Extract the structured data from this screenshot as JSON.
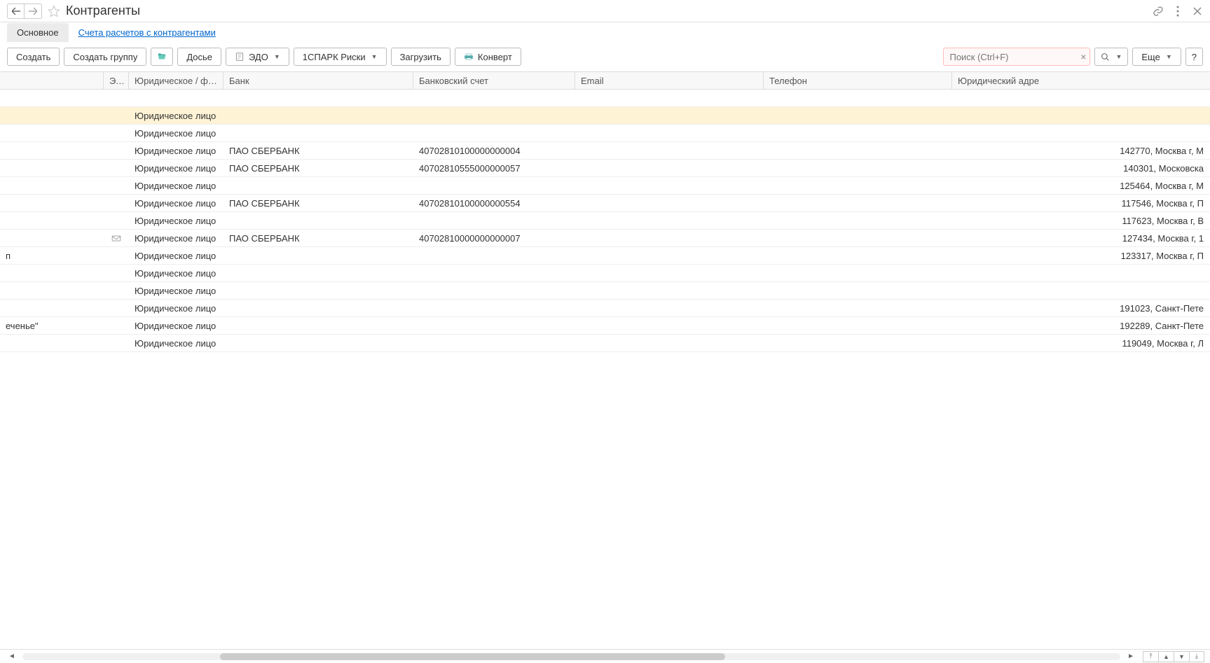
{
  "header": {
    "title": "Контрагенты"
  },
  "tabs": {
    "main": "Основное",
    "accounts": "Счета расчетов с контрагентами"
  },
  "toolbar": {
    "create": "Создать",
    "create_group": "Создать группу",
    "dossier": "Досье",
    "edo": "ЭДО",
    "spark": "1СПАРК Риски",
    "upload": "Загрузить",
    "envelope": "Конверт",
    "search_placeholder": "Поиск (Ctrl+F)",
    "more": "Еще"
  },
  "columns": {
    "edo": "ЭДО",
    "legal": "Юридическое / физич...",
    "bank": "Банк",
    "account": "Банковский счет",
    "email": "Email",
    "phone": "Телефон",
    "addr": "Юридический адре"
  },
  "rows": [
    {
      "name": "",
      "legal": "",
      "bank": "",
      "account": "",
      "email": "",
      "phone": "",
      "addr": "",
      "edo": false,
      "selected": false,
      "blank": true
    },
    {
      "name": "",
      "legal": "Юридическое лицо",
      "bank": "",
      "account": "",
      "email": "",
      "phone": "",
      "addr": "",
      "edo": false,
      "selected": true
    },
    {
      "name": "",
      "legal": "Юридическое лицо",
      "bank": "",
      "account": "",
      "email": "",
      "phone": "",
      "addr": "",
      "edo": false
    },
    {
      "name": "",
      "legal": "Юридическое лицо",
      "bank": "ПАО СБЕРБАНК",
      "account": "40702810100000000004",
      "email": "",
      "phone": "",
      "addr": "142770, Москва г, М",
      "edo": false
    },
    {
      "name": "",
      "legal": "Юридическое лицо",
      "bank": "ПАО СБЕРБАНК",
      "account": "40702810555000000057",
      "email": "",
      "phone": "",
      "addr": "140301, Московска",
      "edo": false
    },
    {
      "name": "",
      "legal": "Юридическое лицо",
      "bank": "",
      "account": "",
      "email": "",
      "phone": "",
      "addr": "125464, Москва г, М",
      "edo": false
    },
    {
      "name": "",
      "legal": "Юридическое лицо",
      "bank": "ПАО СБЕРБАНК",
      "account": "40702810100000000554",
      "email": "",
      "phone": "",
      "addr": "117546, Москва г, П",
      "edo": false
    },
    {
      "name": "",
      "legal": "Юридическое лицо",
      "bank": "",
      "account": "",
      "email": "",
      "phone": "",
      "addr": "117623, Москва г, В",
      "edo": false
    },
    {
      "name": "",
      "legal": "Юридическое лицо",
      "bank": "ПАО СБЕРБАНК",
      "account": "40702810000000000007",
      "email": "",
      "phone": "",
      "addr": "127434, Москва г, 1",
      "edo": true
    },
    {
      "name": "п",
      "legal": "Юридическое лицо",
      "bank": "",
      "account": "",
      "email": "",
      "phone": "",
      "addr": "123317, Москва г, П",
      "edo": false
    },
    {
      "name": "",
      "legal": "Юридическое лицо",
      "bank": "",
      "account": "",
      "email": "",
      "phone": "",
      "addr": "",
      "edo": false
    },
    {
      "name": "",
      "legal": "Юридическое лицо",
      "bank": "",
      "account": "",
      "email": "",
      "phone": "",
      "addr": "",
      "edo": false
    },
    {
      "name": "",
      "legal": "Юридическое лицо",
      "bank": "",
      "account": "",
      "email": "",
      "phone": "",
      "addr": "191023, Санкт-Пете",
      "edo": false
    },
    {
      "name": "еченье\"",
      "legal": "Юридическое лицо",
      "bank": "",
      "account": "",
      "email": "",
      "phone": "",
      "addr": "192289, Санкт-Пете",
      "edo": false
    },
    {
      "name": "",
      "legal": "Юридическое лицо",
      "bank": "",
      "account": "",
      "email": "",
      "phone": "",
      "addr": "119049, Москва г, Л",
      "edo": false
    }
  ]
}
